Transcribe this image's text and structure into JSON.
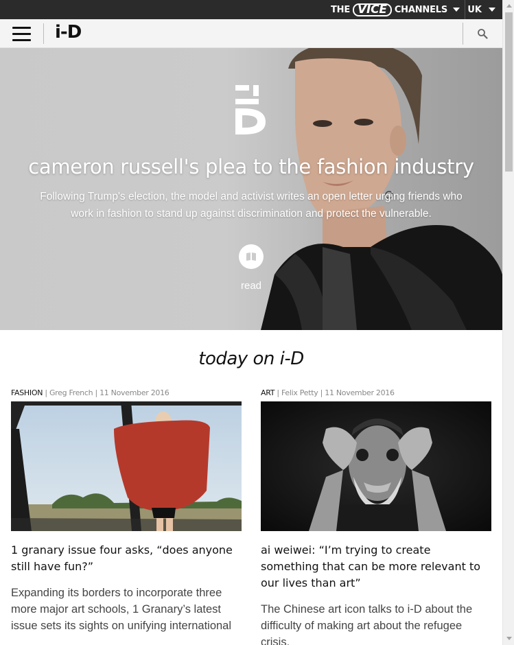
{
  "vice_bar": {
    "the": "THE",
    "vice": "VICE",
    "channels": "CHANNELS",
    "region": "UK"
  },
  "header": {
    "logo": "i-D"
  },
  "hero": {
    "title": "cameron russell's plea to the fashion industry",
    "subtitle": "Following Trump's election, the model and activist writes an open letter urging friends who work in fashion to stand up against discrimination and protect the vulnerable.",
    "read_label": "read"
  },
  "section_title": "today on i-D",
  "articles": [
    {
      "category": "FASHION",
      "author": "Greg French",
      "date": "11 November 2016",
      "title": "1 granary issue four asks, “does anyone still have fun?”",
      "description": "Expanding its borders to incorporate three more major art schools, 1 Granary’s latest issue sets its sights on unifying international"
    },
    {
      "category": "ART",
      "author": "Felix Petty",
      "date": "11 November 2016",
      "title": "ai weiwei: “I’m trying to create something that can be more relevant to our lives than art”",
      "description": "The Chinese art icon talks to i-D about the difficulty of making art about the refugee crisis,"
    }
  ],
  "colors": {
    "vice_bar_bg": "#2b2b2b",
    "header_bg": "#f4f4f4",
    "text": "#111111",
    "meta_text": "#888888"
  }
}
